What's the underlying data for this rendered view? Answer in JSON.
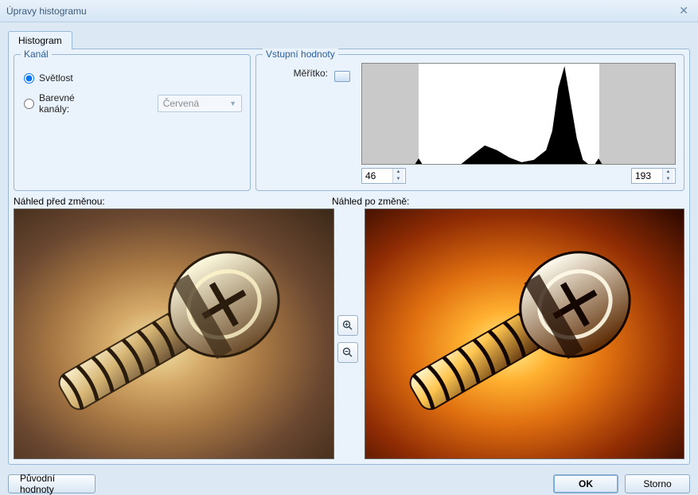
{
  "window": {
    "title": "Úpravy histogramu"
  },
  "tab": {
    "label": "Histogram"
  },
  "kanal": {
    "legend": "Kanál",
    "svetlost": "Světlost",
    "barevne": "Barevné kanály:",
    "combo_value": "Červená"
  },
  "vstup": {
    "legend": "Vstupní hodnoty",
    "meritko": "Měřítko:",
    "low": "46",
    "high": "193"
  },
  "preview": {
    "before": "Náhled před změnou:",
    "after": "Náhled po změně:"
  },
  "buttons": {
    "reset": "Původní hodnoty",
    "ok": "OK",
    "cancel": "Storno"
  },
  "chart_data": {
    "type": "area",
    "title": "",
    "xlabel": "",
    "ylabel": "",
    "xlim": [
      0,
      255
    ],
    "input_black": 46,
    "input_white": 193,
    "x": [
      0,
      10,
      20,
      30,
      40,
      50,
      60,
      70,
      80,
      90,
      100,
      110,
      120,
      130,
      140,
      150,
      155,
      160,
      165,
      170,
      175,
      180,
      190,
      200,
      210,
      220,
      230,
      240,
      255
    ],
    "values": [
      5,
      7,
      9,
      12,
      10,
      8,
      10,
      14,
      18,
      26,
      34,
      30,
      24,
      20,
      22,
      30,
      46,
      82,
      100,
      70,
      40,
      22,
      14,
      8,
      5,
      4,
      3,
      2,
      2
    ]
  }
}
